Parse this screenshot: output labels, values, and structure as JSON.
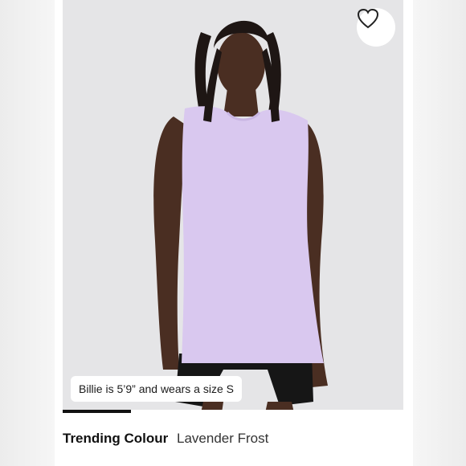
{
  "favorite": {
    "icon": "heart-icon"
  },
  "model_caption": "Billie is 5’9” and wears a size S",
  "gallery": {
    "progress": 0.2
  },
  "colour": {
    "label": "Trending Colour",
    "value": "Lavender Frost"
  },
  "colors": {
    "shirt": "#d9c8ef",
    "background": "#e5e5e7",
    "indicator": "#111111"
  }
}
